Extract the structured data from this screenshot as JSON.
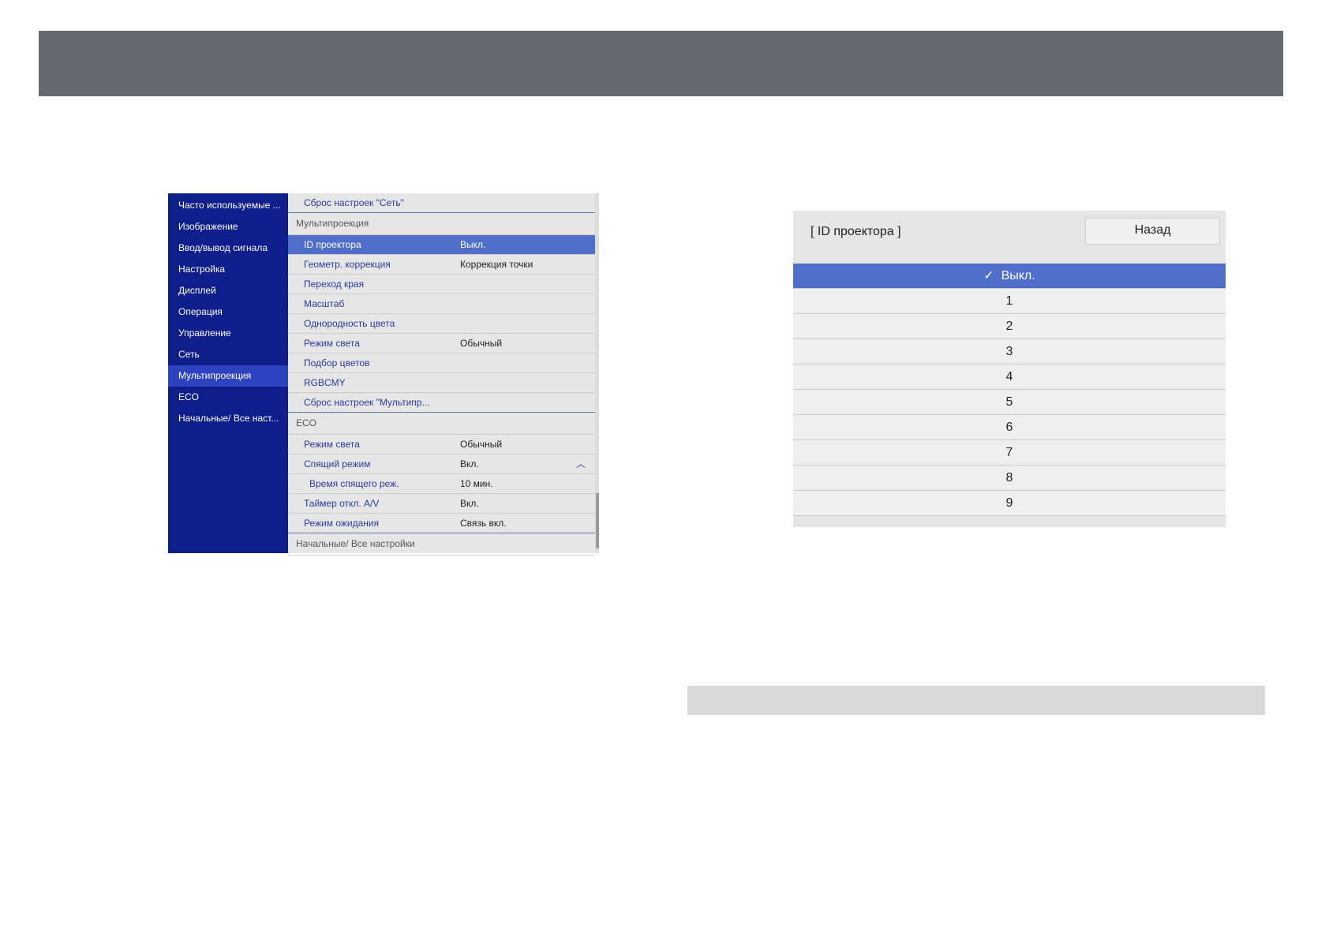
{
  "sidebar": [
    "Часто используемые ...",
    "Изображение",
    "Ввод/вывод сигнала",
    "Настройка",
    "Дисплей",
    "Операция",
    "Управление",
    "Сеть",
    "Мультипроекция",
    "ECO",
    "Начальные/ Все наст..."
  ],
  "content": {
    "top_item": "Сброс настроек \"Сеть\"",
    "multi_header": "Мультипроекция",
    "multi_items": [
      {
        "label": "ID проектора",
        "value": "Выкл."
      },
      {
        "label": "Геометр. коррекция",
        "value": "Коррекция точки"
      },
      {
        "label": "Переход края",
        "value": ""
      },
      {
        "label": "Масштаб",
        "value": ""
      },
      {
        "label": "Однородность цвета",
        "value": ""
      },
      {
        "label": "Режим света",
        "value": "Обычный"
      },
      {
        "label": "Подбор цветов",
        "value": ""
      },
      {
        "label": "RGBCMY",
        "value": ""
      },
      {
        "label": "Сброс настроек \"Мультипр...",
        "value": ""
      }
    ],
    "eco_header": "ECO",
    "eco_items": [
      {
        "label": "Режим света",
        "value": "Обычный"
      },
      {
        "label": "Спящий режим",
        "value": "Вкл."
      },
      {
        "label": "Время спящего реж.",
        "value": "10 мин."
      },
      {
        "label": "Таймер откл. A/V",
        "value": "Вкл."
      },
      {
        "label": "Режим ожидания",
        "value": "Связь вкл."
      }
    ],
    "bottom_header": "Начальные/ Все настройки"
  },
  "panel": {
    "title": "[ ID проектора ]",
    "back": "Назад",
    "options": [
      "Выкл.",
      "1",
      "2",
      "3",
      "4",
      "5",
      "6",
      "7",
      "8",
      "9"
    ],
    "selected_check": "✓"
  }
}
